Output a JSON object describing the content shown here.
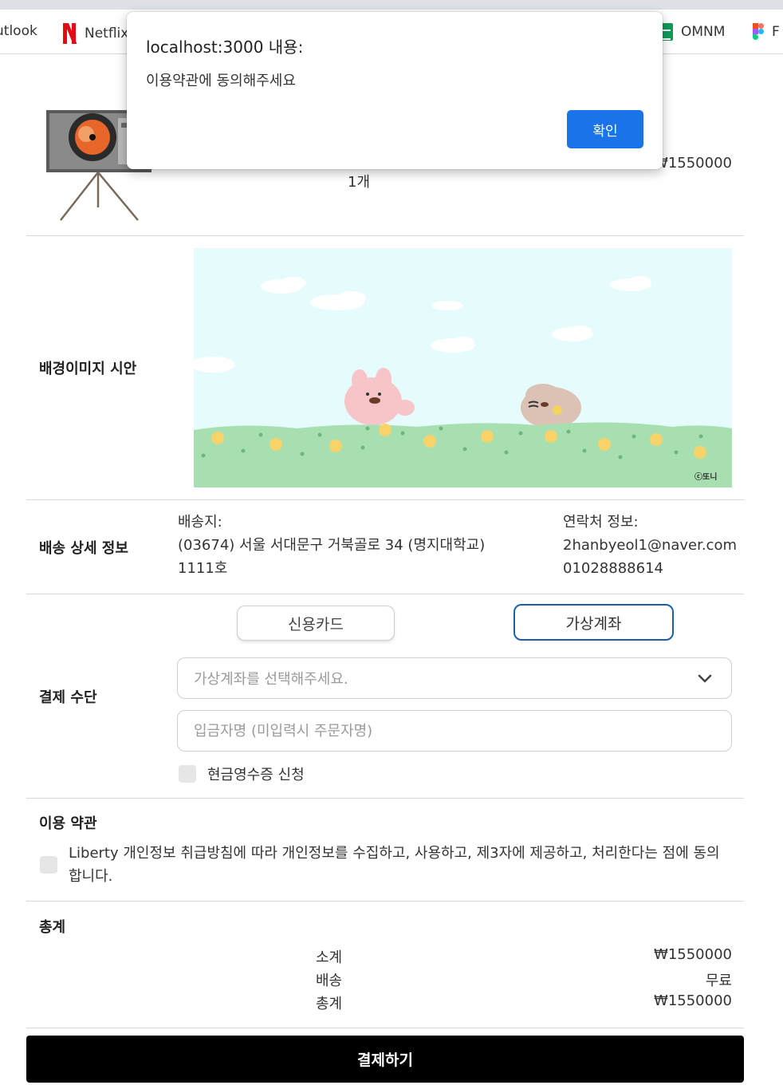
{
  "bookmarks": {
    "outlook": "utlook",
    "netflix": "Netflix",
    "omnm": "OMNM",
    "figma": "F"
  },
  "product": {
    "quantity": "1개",
    "price": "₩1550000"
  },
  "background_preview": {
    "label": "배경이미지 시안",
    "watermark": "ⓒ또니"
  },
  "shipping": {
    "label": "배송 상세 정보",
    "address_title": "배송지:",
    "address_line1": "(03674) 서울 서대문구 거북골로 34 (명지대학교)",
    "address_line2": "1111호",
    "contact_title": "연락처 정보:",
    "email": "2hanbyeol1@naver.com",
    "phone": "01028888614"
  },
  "payment": {
    "label": "결제 수단",
    "card_button": "신용카드",
    "virtual_button": "가상계좌",
    "selected": "가상계좌",
    "account_select_placeholder": "가상계좌를 선택해주세요.",
    "depositor_placeholder": "입금자명 (미입력시 주문자명)",
    "cash_receipt_label": "현금영수증 신청"
  },
  "terms": {
    "label": "이용 약관",
    "agreement_text": "Liberty 개인정보 취급방침에 따라 개인정보를 수집하고, 사용하고, 제3자에 제공하고, 처리한다는 점에 동의합니다."
  },
  "totals": {
    "label": "총계",
    "rows": [
      {
        "name": "소계",
        "value": "₩1550000"
      },
      {
        "name": "배송",
        "value": "무료"
      },
      {
        "name": "총계",
        "value": "₩1550000"
      }
    ]
  },
  "checkout_button": "결제하기",
  "dialog": {
    "title": "localhost:3000 내용:",
    "message": "이용약관에 동의해주세요",
    "ok_button": "확인"
  },
  "colors": {
    "primary_blue": "#1a73e8",
    "selected_border": "#1b5fa8",
    "checkout_bg": "#000000"
  }
}
